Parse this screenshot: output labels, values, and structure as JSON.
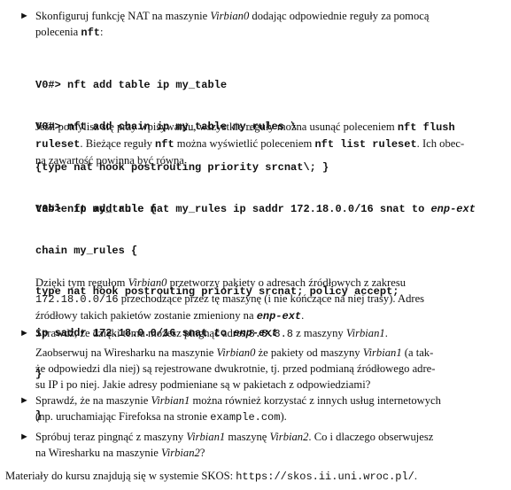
{
  "bullet_glyph": "►",
  "item1": {
    "line1_a": "Skonfiguruj funkcję NAT na maszynie ",
    "line1_host": "Virbian0",
    "line1_b": " dodając odpowiednie reguły za pomocą",
    "line2_a": "polecenia ",
    "line2_cmd": "nft",
    "line2_b": ":",
    "code1": [
      {
        "prompt": "V0#>",
        "text": " nft add table ip my_table"
      },
      {
        "prompt": "V0#>",
        "text": " nft add chain ip my_table my_rules \\"
      },
      {
        "prompt": "",
        "text": "     {type nat hook postrouting priority srcnat\\; }"
      },
      {
        "prompt": "V0#>",
        "text": " nft add rule nat my_rules ip saddr 172.18.0.0/16 snat to ",
        "tail": "enp-ext"
      }
    ],
    "para2": {
      "l1_a": "Jeśli pomylisz się przy wpisywaniu, wszystkie reguły można usunąć poleceniem ",
      "l1_cmd": "nft flush",
      "l2_cmd": "ruleset",
      "l2_a": ". Bieżące reguły ",
      "l2_cmd2": "nft",
      "l2_b": " można wyświetlić poleceniem ",
      "l2_cmd3": "nft list ruleset",
      "l2_c": ". Ich obec-",
      "l3": "na zawartość powinna być równa"
    },
    "code2": [
      {
        "text": "table ip my_table {"
      },
      {
        "text": "   chain my_rules {"
      },
      {
        "text": "     type nat hook postrouting priority srcnat; policy accept;"
      },
      {
        "text": "     ip saddr 172.18.0.0/16 snat to ",
        "tail": "enp-ext"
      },
      {
        "text": "   }"
      },
      {
        "text": "}"
      }
    ],
    "para3": {
      "l1_a": "Dzięki tym regułom ",
      "l1_host": "Virbian0",
      "l1_b": " przetworzy pakiety o adresach źródłowych z zakresu",
      "l2_net": "172.18.0.0/16",
      "l2_a": " przechodzące przez tę maszynę (i nie kończące na niej trasy). Adres",
      "l3_a": "źródłowy takich pakietów zostanie zmieniony na ",
      "l3_if": "enp-ext",
      "l3_b": "."
    }
  },
  "item2": {
    "l1_a": "Sprawdź, że dzięki temu możesz pingnąć adres ",
    "l1_ip": "8.8.8.8",
    "l1_b": " z maszyny ",
    "l1_host": "Virbian1",
    "l1_c": ".",
    "p2_l1_a": "Zaobserwuj na Wiresharku na maszynie ",
    "p2_l1_host": "Virbian0",
    "p2_l1_b": " że pakiety od maszyny ",
    "p2_l1_host2": "Virbian1",
    "p2_l1_c": " (a tak-",
    "p2_l2": "że odpowiedzi dla niej) są rejestrowane dwukrotnie, tj. przed podmianą źródłowego adre-",
    "p2_l3": "su IP i po niej. Jakie adresy podmieniane są w pakietach z odpowiedziami?"
  },
  "item3": {
    "l1_a": "Sprawdź, że na maszynie ",
    "l1_host": "Virbian1",
    "l1_b": " można również korzystać z innych usług internetowych",
    "l2_a": "(np. uruchamiając Firefoksa na stronie ",
    "l2_site": "example.com",
    "l2_b": ")."
  },
  "item4": {
    "l1_a": "Spróbuj teraz pingnąć z maszyny ",
    "l1_host": "Virbian1",
    "l1_b": " maszynę ",
    "l1_host2": "Virbian2",
    "l1_c": ". Co i dlaczego obserwujesz",
    "l2_a": "na Wiresharku na maszynie ",
    "l2_host": "Virbian2",
    "l2_b": "?"
  },
  "footer": {
    "text": "Materiały do kursu znajdują się w systemie SKOS: ",
    "url": "https://skos.ii.uni.wroc.pl/",
    "end": "."
  }
}
